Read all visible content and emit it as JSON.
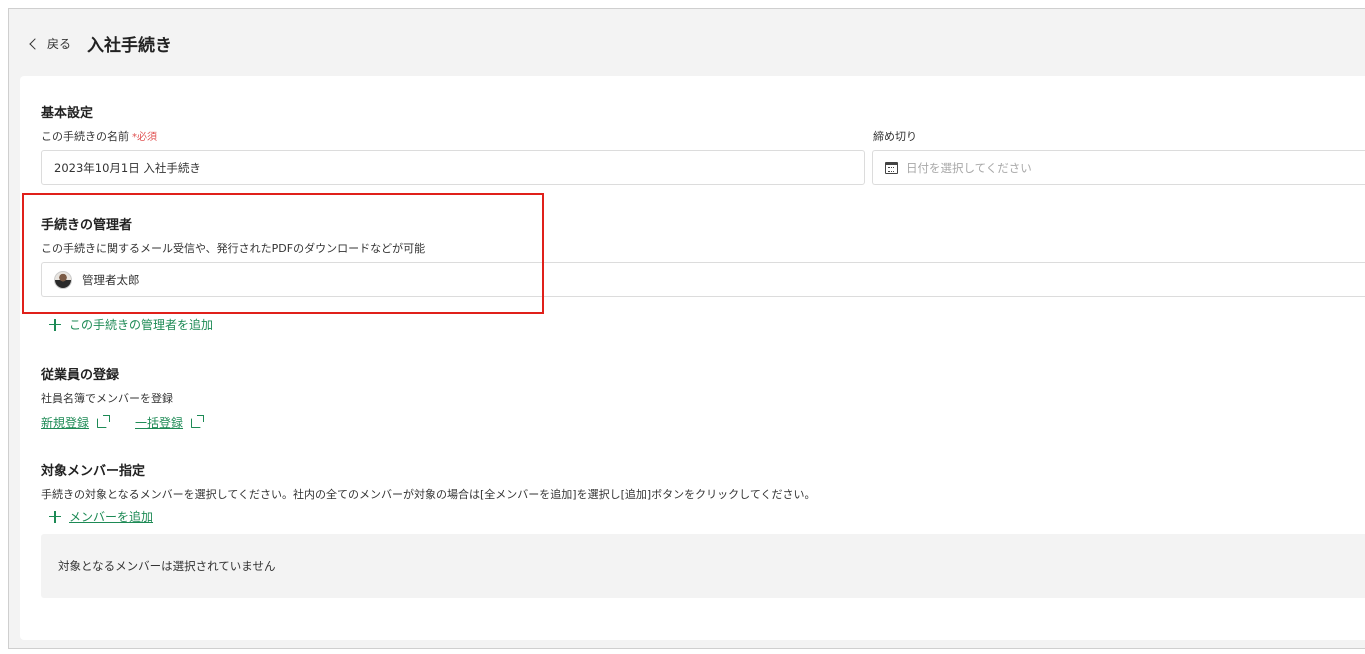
{
  "header": {
    "back_label": "戻る",
    "title": "入社手続き"
  },
  "basic": {
    "title": "基本設定",
    "name_label": "この手続きの名前",
    "required_label": "*必須",
    "name_value": "2023年10月1日 入社手続き",
    "deadline_label": "締め切り",
    "deadline_placeholder": "日付を選択してください"
  },
  "admins": {
    "title": "手続きの管理者",
    "description": "この手続きに関するメール受信や、発行されたPDFのダウンロードなどが可能",
    "selected": "管理者太郎",
    "add_label": "この手続きの管理者を追加"
  },
  "employee": {
    "title": "従業員の登録",
    "description": "社員名簿でメンバーを登録",
    "new_label": "新規登録",
    "bulk_label": "一括登録"
  },
  "members": {
    "title": "対象メンバー指定",
    "description": "手続きの対象となるメンバーを選択してください。社内の全てのメンバーが対象の場合は[全メンバーを追加]を選択し[追加]ボタンをクリックしてください。",
    "add_label": "メンバーを追加",
    "empty_text": "対象となるメンバーは選択されていません"
  },
  "colors": {
    "accent": "#1d8a55",
    "required": "#e05252",
    "highlight": "#e0201a"
  }
}
